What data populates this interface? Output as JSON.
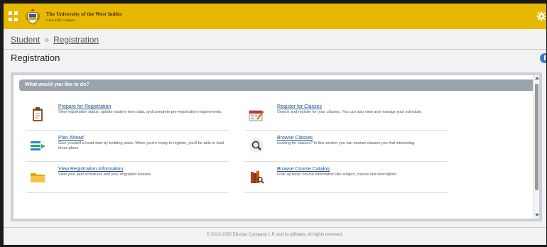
{
  "header": {
    "university_line1": "The University of the West Indies",
    "university_line2": "Cave Hill Campus",
    "accent_color": "#e6b800"
  },
  "breadcrumb": {
    "items": [
      "Student",
      "Registration"
    ],
    "separator": "»"
  },
  "page": {
    "title": "Registration"
  },
  "panel": {
    "header": "What would you like to do?",
    "items": [
      {
        "title": "Prepare for Registration",
        "description": "View registration status, update student term data, and complete pre-registration requirements.",
        "icon": "clipboard-icon"
      },
      {
        "title": "Register for Classes",
        "description": "Search and register for your classes. You can also view and manage your schedule.",
        "icon": "calendar-edit-icon"
      },
      {
        "title": "Plan Ahead",
        "description": "Give yourself a head start by building plans. When you're ready to register, you'll be able to load these plans.",
        "icon": "plan-list-icon"
      },
      {
        "title": "Browse Classes",
        "description": "Looking for classes? In this section you can browse classes you find interesting.",
        "icon": "magnifier-icon"
      },
      {
        "title": "View Registration Information",
        "description": "View your past schedules and your ungraded classes.",
        "icon": "folder-icon"
      },
      {
        "title": "Browse Course Catalog",
        "description": "Look up basic course information like subject, course and description.",
        "icon": "books-icon"
      }
    ]
  },
  "footer": {
    "copyright": "© 2013-2025 Ellucian Company L.P. and its affiliates. All rights reserved."
  }
}
